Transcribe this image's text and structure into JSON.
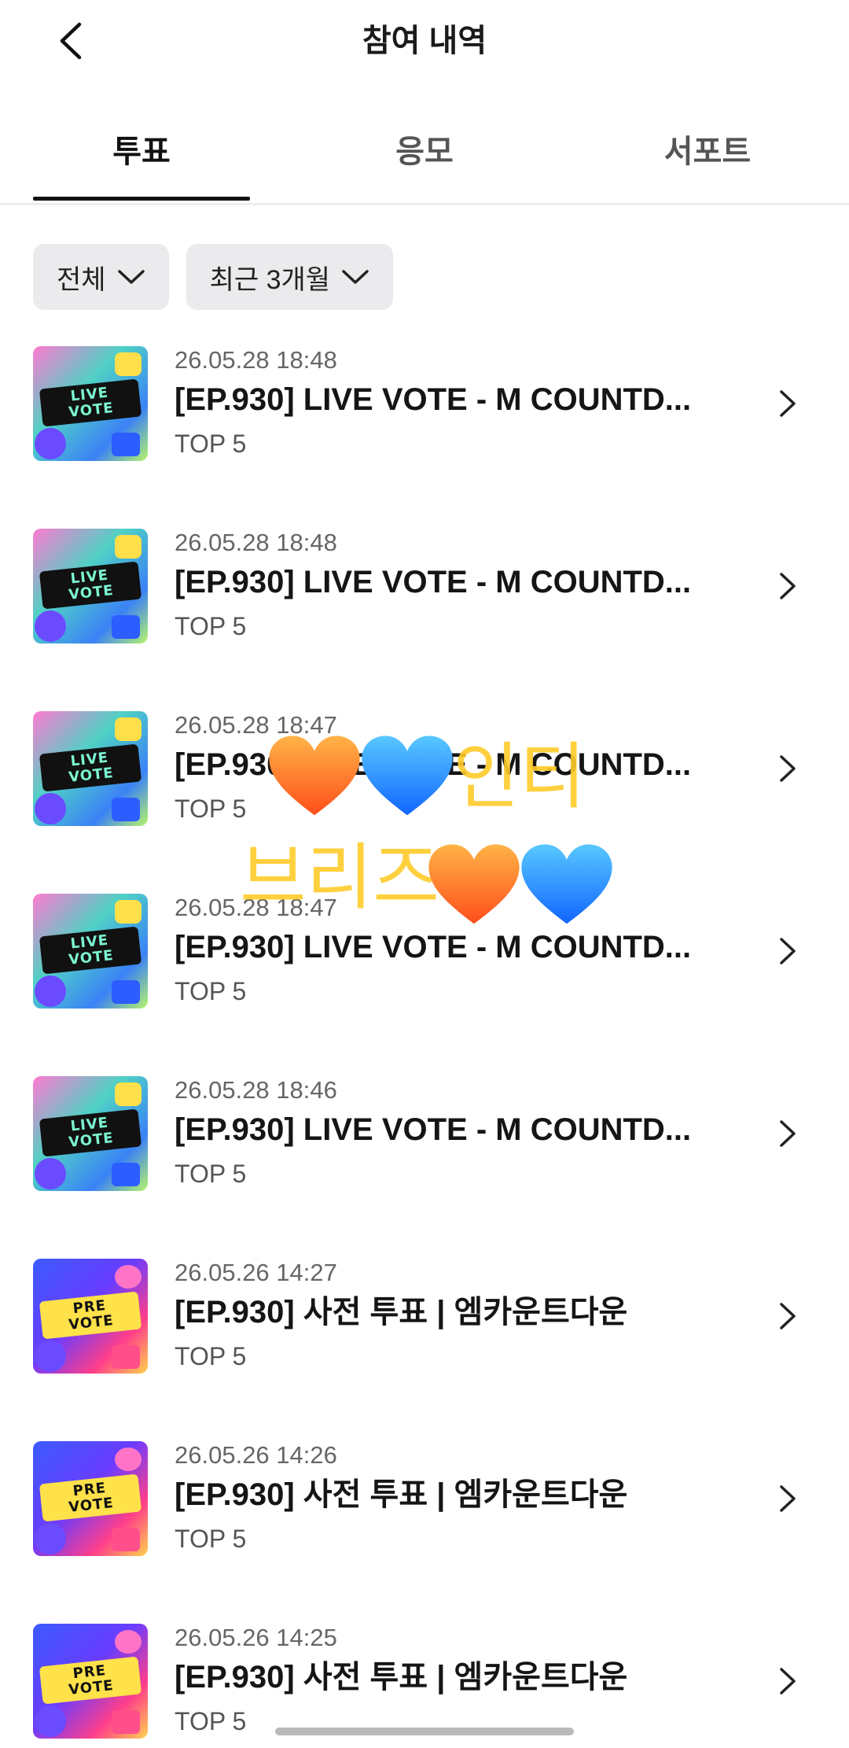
{
  "header": {
    "title": "참여 내역"
  },
  "tabs": [
    {
      "label": "투표",
      "active": true
    },
    {
      "label": "응모",
      "active": false
    },
    {
      "label": "서포트",
      "active": false
    }
  ],
  "filters": [
    {
      "label": "전체"
    },
    {
      "label": "최근 3개월"
    }
  ],
  "items": [
    {
      "date": "26.05.28 18:48",
      "title": "[EP.930] LIVE VOTE - M COUNTD...",
      "rank": "TOP 5",
      "thumb_top": "LIVE",
      "thumb_bottom": "VOTE"
    },
    {
      "date": "26.05.28 18:48",
      "title": "[EP.930] LIVE VOTE - M COUNTD...",
      "rank": "TOP 5",
      "thumb_top": "LIVE",
      "thumb_bottom": "VOTE"
    },
    {
      "date": "26.05.28 18:47",
      "title": "[EP.930] LIVE VOTE - M COUNTD...",
      "rank": "TOP 5",
      "thumb_top": "LIVE",
      "thumb_bottom": "VOTE"
    },
    {
      "date": "26.05.28 18:47",
      "title": "[EP.930] LIVE VOTE - M COUNTD...",
      "rank": "TOP 5",
      "thumb_top": "LIVE",
      "thumb_bottom": "VOTE"
    },
    {
      "date": "26.05.28 18:46",
      "title": "[EP.930] LIVE VOTE - M COUNTD...",
      "rank": "TOP 5",
      "thumb_top": "LIVE",
      "thumb_bottom": "VOTE"
    },
    {
      "date": "26.05.26 14:27",
      "title": "[EP.930] 사전 투표 | 엠카운트다운",
      "rank": "TOP 5",
      "thumb_top": "PRE",
      "thumb_bottom": "VOTE"
    },
    {
      "date": "26.05.26 14:26",
      "title": "[EP.930] 사전 투표 | 엠카운트다운",
      "rank": "TOP 5",
      "thumb_top": "PRE",
      "thumb_bottom": "VOTE"
    },
    {
      "date": "26.05.26 14:25",
      "title": "[EP.930] 사전 투표 | 엠카운트다운",
      "rank": "TOP 5",
      "thumb_top": "PRE",
      "thumb_bottom": "VOTE"
    }
  ],
  "overlay": {
    "line1": "인티",
    "line2": "브리즈"
  },
  "colors": {
    "accent": "#111111",
    "chip_bg": "#ebebee",
    "overlay_text": "#ffcc2a",
    "heart_orange": "#ff7a1a",
    "heart_blue": "#1e8cff"
  }
}
